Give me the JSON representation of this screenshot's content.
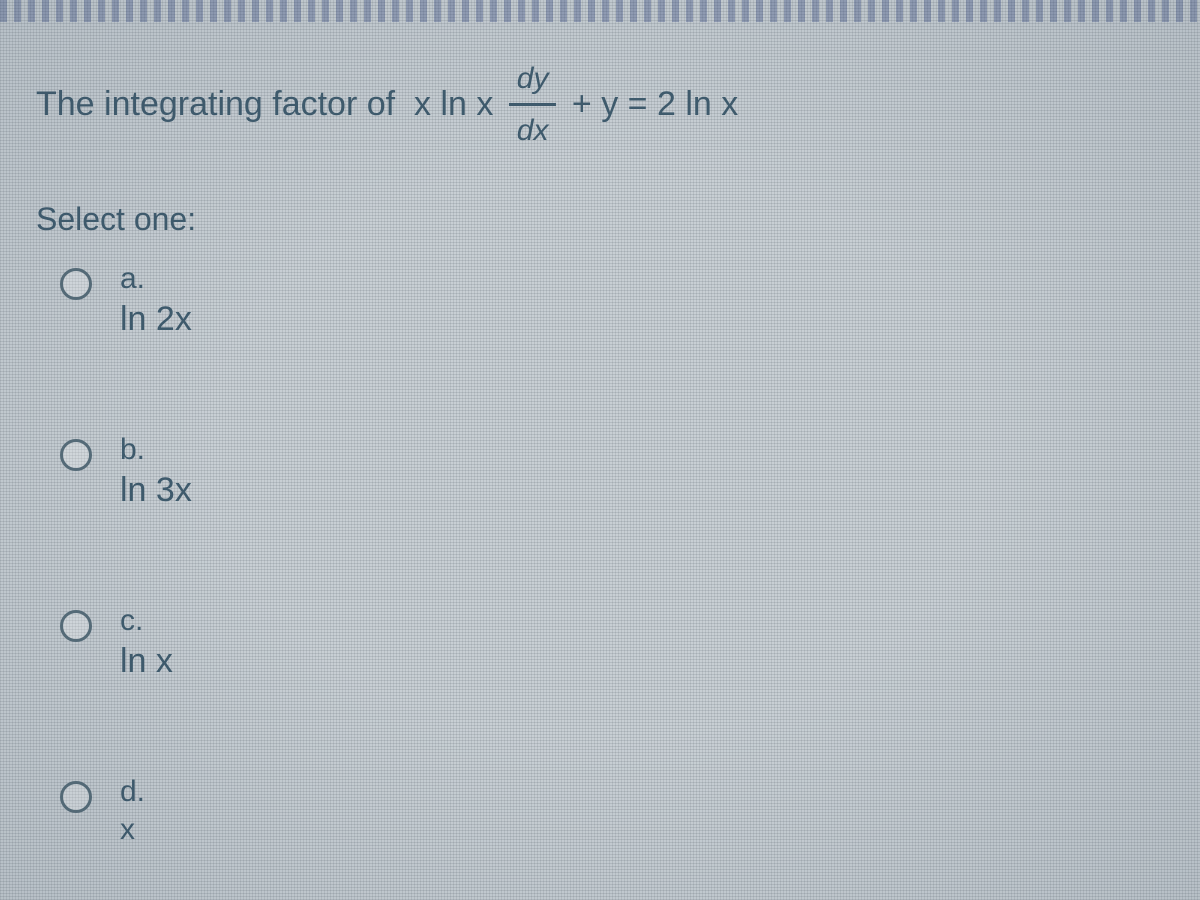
{
  "question": {
    "prefix": "The integrating factor of  x ln x ",
    "frac_num": "dy",
    "frac_den": "dx",
    "suffix": " + y = 2 ln x"
  },
  "prompt": "Select one:",
  "options": [
    {
      "letter": "a.",
      "value": "ln 2x"
    },
    {
      "letter": "b.",
      "value": "ln 3x"
    },
    {
      "letter": "c.",
      "value": "ln x"
    },
    {
      "letter": "d.",
      "value": "x"
    }
  ]
}
